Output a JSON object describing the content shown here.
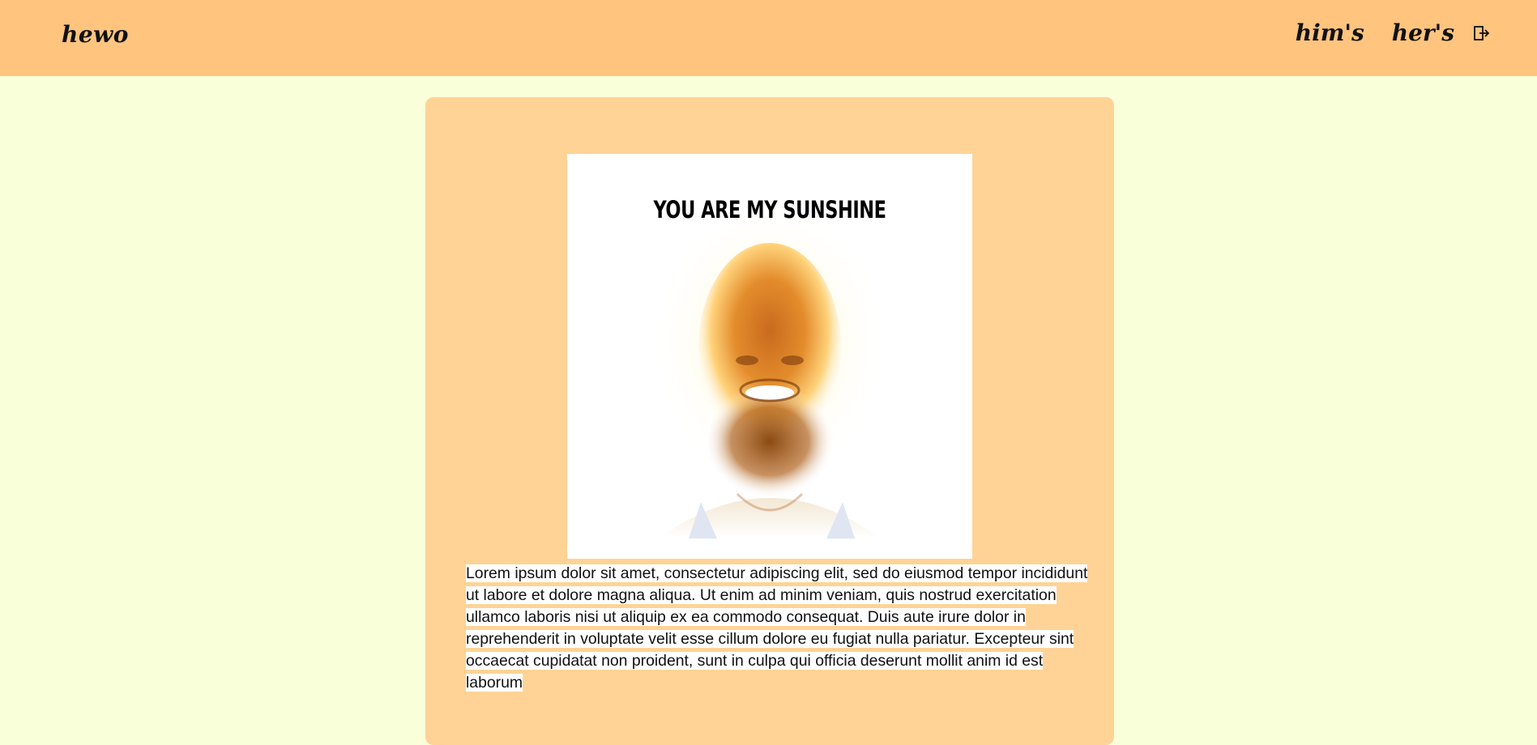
{
  "header": {
    "brand": "hewo",
    "nav": [
      {
        "label": "him's"
      },
      {
        "label": "her's"
      }
    ],
    "logout_icon": "logout-icon"
  },
  "post": {
    "image": {
      "caption": "YOU ARE MY SUNSHINE",
      "subject": "glowing-portrait"
    },
    "text": "Lorem ipsum dolor sit amet, consectetur adipiscing elit, sed do eiusmod tempor incididunt ut labore et dolore magna aliqua. Ut enim ad minim veniam, quis nostrud exercitation ullamco laboris nisi ut aliquip ex ea commodo consequat. Duis aute irure dolor in reprehenderit in voluptate velit esse cillum dolore eu fugiat nulla pariatur. Excepteur sint occaecat cupidatat non proident, sunt in culpa qui officia deserunt mollit anim id est laborum"
  },
  "colors": {
    "page_bg": "#f9ffd9",
    "topbar_bg": "#ffc47e",
    "card_bg": "#ffd396"
  }
}
